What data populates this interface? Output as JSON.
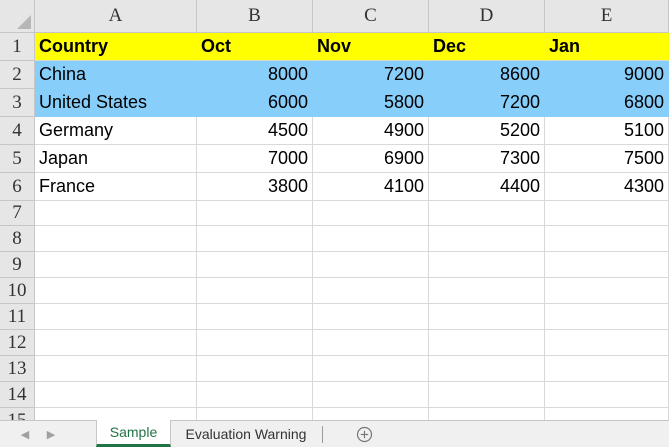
{
  "columns": [
    "A",
    "B",
    "C",
    "D",
    "E"
  ],
  "rows": [
    "1",
    "2",
    "3",
    "4",
    "5",
    "6",
    "7",
    "8",
    "9",
    "10",
    "11",
    "12",
    "13",
    "14",
    "15"
  ],
  "table": [
    [
      "Country",
      "Oct",
      "Nov",
      "Dec",
      "Jan"
    ],
    [
      "China",
      "8000",
      "7200",
      "8600",
      "9000"
    ],
    [
      "United States",
      "6000",
      "5800",
      "7200",
      "6800"
    ],
    [
      "Germany",
      "4500",
      "4900",
      "5200",
      "5100"
    ],
    [
      "Japan",
      "7000",
      "6900",
      "7300",
      "7500"
    ],
    [
      "France",
      "3800",
      "4100",
      "4400",
      "4300"
    ]
  ],
  "header_row_color": "#ffff00",
  "highlight_row_color": "#87cefa",
  "highlighted_rows": [
    1,
    2
  ],
  "sheet_tabs": [
    {
      "label": "Sample",
      "active": true
    },
    {
      "label": "Evaluation Warning",
      "active": false
    }
  ],
  "icons": {
    "prev_sheet": "chevron-left-icon",
    "next_sheet": "chevron-right-icon",
    "new_sheet": "plus-circle-icon"
  }
}
